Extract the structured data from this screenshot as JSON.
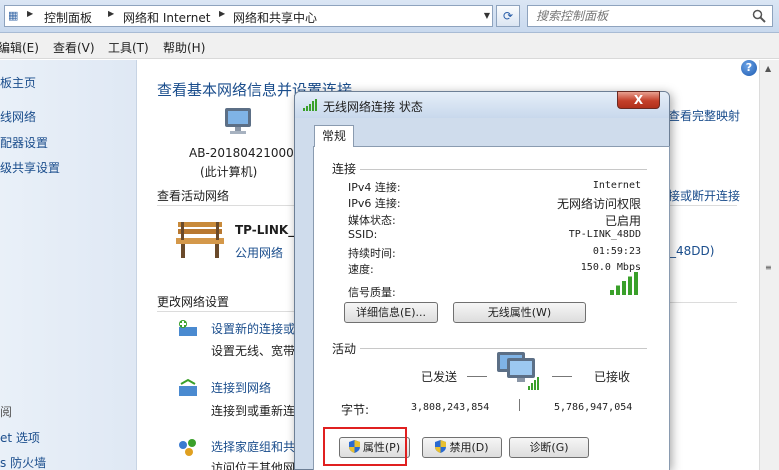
{
  "address_bar": {
    "crumbs": [
      "控制面板",
      "网络和 Internet",
      "网络和共享中心"
    ],
    "search_placeholder": "搜索控制面板"
  },
  "menu": [
    "编辑(E)",
    "查看(V)",
    "工具(T)",
    "帮助(H)"
  ],
  "sidebar": {
    "items": [
      "板主页",
      "线网络",
      "配器设置",
      "级共享设置"
    ],
    "see_also": [
      "阅",
      "et 选项",
      "s 防火墙"
    ]
  },
  "content": {
    "heading": "查看基本网络信息并设置连接",
    "computer_name": "AB-20180421000",
    "computer_sub": "(此计算机)",
    "full_map_link": "查看完整映射",
    "active_networks_label": "查看活动网络",
    "connect_disconnect_link": "接或断开连接",
    "network_name": "TP-LINK_4",
    "network_type": "公用网络",
    "network_conn_link": "_48DD)",
    "change_settings_label": "更改网络设置",
    "tasks": [
      {
        "link": "设置新的连接或",
        "desc": "设置无线、宽带"
      },
      {
        "link": "连接到网络",
        "desc": "连接到或重新连"
      },
      {
        "link": "选择家庭组和共",
        "desc": "访问位于其他网"
      }
    ]
  },
  "dialog": {
    "title": "无线网络连接 状态",
    "close_label": "X",
    "tab": "常规",
    "connection_group": "连接",
    "rows": [
      {
        "label": "IPv4 连接:",
        "value": "Internet"
      },
      {
        "label": "IPv6 连接:",
        "value": "无网络访问权限"
      },
      {
        "label": "媒体状态:",
        "value": "已启用"
      },
      {
        "label": "SSID:",
        "value": "TP-LINK_48DD"
      },
      {
        "label": "持续时间:",
        "value": "01:59:23"
      },
      {
        "label": "速度:",
        "value": "150.0 Mbps"
      }
    ],
    "signal_label": "信号质量:",
    "signal_bars": 5,
    "details_button": "详细信息(E)...",
    "wireless_props_button": "无线属性(W)",
    "activity_group": "活动",
    "sent_label": "已发送",
    "received_label": "已接收",
    "bytes_label": "字节:",
    "bytes_sent": "3,808,243,854",
    "bytes_received": "5,786,947,054",
    "properties_button": "属性(P)",
    "disable_button": "禁用(D)",
    "diagnose_button": "诊断(G)"
  },
  "colors": {
    "link": "#1a4d8c",
    "highlight": "#e02020",
    "signal": "#3aa02a"
  }
}
